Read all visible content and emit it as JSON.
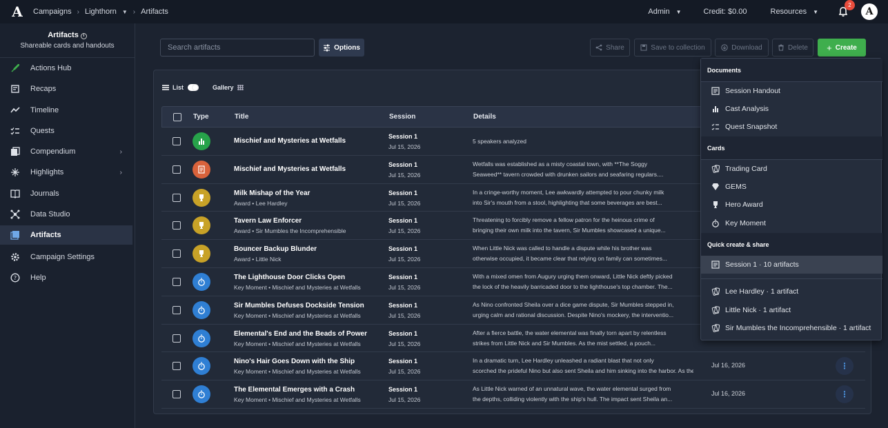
{
  "topbar": {
    "breadcrumbs": [
      "Campaigns",
      "Lighthorn",
      "Artifacts"
    ],
    "admin_label": "Admin",
    "credit_label": "Credit: $0.00",
    "resources_label": "Resources",
    "notification_count": "2",
    "avatar_letter": "A",
    "logo_letter": "A"
  },
  "sidebar": {
    "title": "Artifacts",
    "subtitle": "Shareable cards and handouts",
    "items": [
      {
        "label": "Actions Hub",
        "icon": "rocket-icon"
      },
      {
        "label": "Recaps",
        "icon": "recap-icon"
      },
      {
        "label": "Timeline",
        "icon": "timeline-icon"
      },
      {
        "label": "Quests",
        "icon": "checklist-icon"
      },
      {
        "label": "Compendium",
        "icon": "book-icon"
      },
      {
        "label": "Highlights",
        "icon": "sparkle-icon"
      },
      {
        "label": "Journals",
        "icon": "journal-icon"
      },
      {
        "label": "Data Studio",
        "icon": "network-icon"
      },
      {
        "label": "Artifacts",
        "icon": "artifacts-icon",
        "active": true
      },
      {
        "label": "Campaign Settings",
        "icon": "gear-icon"
      },
      {
        "label": "Help",
        "icon": "help-icon"
      }
    ]
  },
  "toolbar": {
    "search_placeholder": "Search artifacts",
    "options_label": "Options",
    "share_label": "Share",
    "save_label": "Save to collection",
    "download_label": "Download",
    "delete_label": "Delete",
    "create_label": "Create"
  },
  "view": {
    "list_label": "List",
    "gallery_label": "Gallery"
  },
  "table": {
    "headers": [
      "Type",
      "Title",
      "Session",
      "Details"
    ],
    "rows": [
      {
        "type": "chart",
        "title": "Mischief and Mysteries at Wetfalls",
        "sub": "",
        "session": "Session 1",
        "date": "Jul 15, 2026",
        "d1": "5 speakers analyzed",
        "d2": "",
        "date2": ""
      },
      {
        "type": "doc",
        "title": "Mischief and Mysteries at Wetfalls",
        "sub": "",
        "session": "Session 1",
        "date": "Jul 15, 2026",
        "d1": "Wetfalls was established as a misty coastal town, with **The Soggy",
        "d2": "Seaweed** tavern crowded with drunken sailors and seafaring regulars....",
        "date2": ""
      },
      {
        "type": "award",
        "title": "Milk Mishap of the Year",
        "sub": "Award • Lee Hardley",
        "session": "Session 1",
        "date": "Jul 15, 2026",
        "d1": "In a cringe-worthy moment, Lee awkwardly attempted to pour chunky milk",
        "d2": "into Sir's mouth from a stool, highlighting that some beverages are best...",
        "date2": ""
      },
      {
        "type": "award",
        "title": "Tavern Law Enforcer",
        "sub": "Award • Sir Mumbles the Incomprehensible",
        "session": "Session 1",
        "date": "Jul 15, 2026",
        "d1": "Threatening to forcibly remove a fellow patron for the heinous crime of",
        "d2": "bringing their own milk into the tavern, Sir Mumbles showcased a unique...",
        "date2": ""
      },
      {
        "type": "award",
        "title": "Bouncer Backup Blunder",
        "sub": "Award • Little Nick",
        "session": "Session 1",
        "date": "Jul 15, 2026",
        "d1": "When Little Nick was called to handle a dispute while his brother was",
        "d2": "otherwise occupied, it became clear that relying on family can sometimes...",
        "date2": ""
      },
      {
        "type": "moment",
        "title": "The Lighthouse Door Clicks Open",
        "sub": "Key Moment • Mischief and Mysteries at Wetfalls",
        "session": "Session 1",
        "date": "Jul 15, 2026",
        "d1": "With a mixed omen from Augury urging them onward, Little Nick deftly picked",
        "d2": "the lock of the heavily barricaded door to the lighthouse's top chamber. The...",
        "date2": ""
      },
      {
        "type": "moment",
        "title": "Sir Mumbles Defuses Dockside Tension",
        "sub": "Key Moment • Mischief and Mysteries at Wetfalls",
        "session": "Session 1",
        "date": "Jul 15, 2026",
        "d1": "As Nino confronted Sheila over a dice game dispute, Sir Mumbles stepped in,",
        "d2": "urging calm and rational discussion. Despite Nino's mockery, the interventio...",
        "date2": ""
      },
      {
        "type": "moment",
        "title": "Elemental's End and the Beads of Power",
        "sub": "Key Moment • Mischief and Mysteries at Wetfalls",
        "session": "Session 1",
        "date": "Jul 15, 2026",
        "d1": "After a fierce battle, the water elemental was finally torn apart by relentless",
        "d2": "strikes from Little Nick and Sir Mumbles. As the mist settled, a pouch...",
        "date2": ""
      },
      {
        "type": "moment",
        "title": "Nino's Hair Goes Down with the Ship",
        "sub": "Key Moment • Mischief and Mysteries at Wetfalls",
        "session": "Session 1",
        "date": "Jul 15, 2026",
        "d1": "In a dramatic turn, Lee Hardley unleashed a radiant blast that not only",
        "d2": "scorched the prideful Nino but also sent Sheila and him sinking into the harbor. As the...",
        "date2": "Jul 16, 2026"
      },
      {
        "type": "moment",
        "title": "The Elemental Emerges with a Crash",
        "sub": "Key Moment • Mischief and Mysteries at Wetfalls",
        "session": "Session 1",
        "date": "Jul 15, 2026",
        "d1": "As Little Nick warned of an unnatural wave, the water elemental surged from",
        "d2": "the depths, colliding violently with the ship's hull. The impact sent Sheila an...",
        "date2": "Jul 16, 2026"
      }
    ]
  },
  "menu": {
    "documents_header": "Documents",
    "documents": [
      "Session Handout",
      "Cast Analysis",
      "Quest Snapshot"
    ],
    "cards_header": "Cards",
    "cards": [
      "Trading Card",
      "GEMS",
      "Hero Award",
      "Key Moment"
    ],
    "quick_header": "Quick create & share",
    "quick": [
      "Session 1 · 10 artifacts"
    ],
    "people": [
      "Lee Hardley · 1 artifact",
      "Little Nick · 1 artifact",
      "Sir Mumbles the Incomprehensible · 1 artifact"
    ]
  },
  "colors": {
    "accent_green": "#3fae4d",
    "award_gold": "#c8a227",
    "moment_blue": "#2f7fd4",
    "chart_green": "#27a34a",
    "doc_orange": "#d9623b"
  }
}
